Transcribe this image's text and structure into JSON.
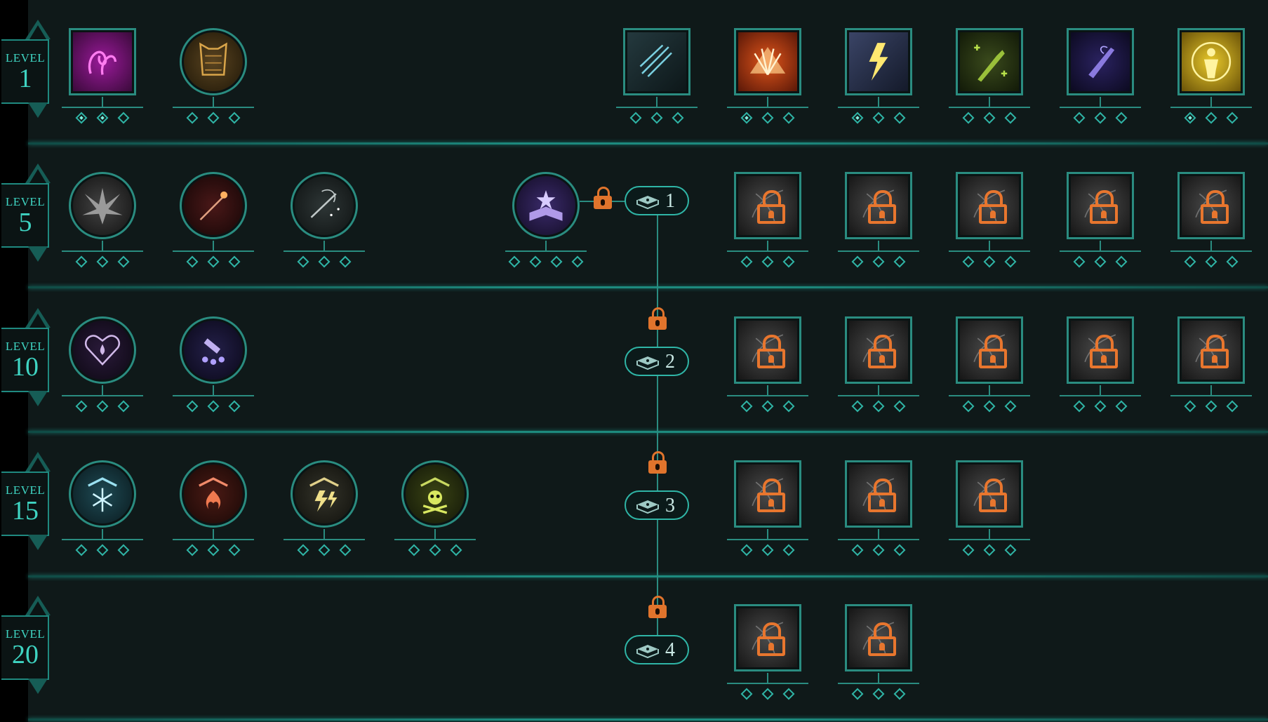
{
  "levels": [
    {
      "label": "LEVEL",
      "number": "1"
    },
    {
      "label": "LEVEL",
      "number": "5"
    },
    {
      "label": "LEVEL",
      "number": "10"
    },
    {
      "label": "LEVEL",
      "number": "15"
    },
    {
      "label": "LEVEL",
      "number": "20"
    }
  ],
  "unlock_tiers": [
    "1",
    "2",
    "3",
    "4"
  ],
  "colors": {
    "background": "#0f1919",
    "accent": "#2fb5a6",
    "level_text": "#3fd4c2",
    "lock": "#e0742c"
  },
  "rows": [
    {
      "level": "1",
      "talents": [
        {
          "icon": "magenta-wisps-icon",
          "shape": "square",
          "pips": 3,
          "filled": 2
        },
        {
          "icon": "golden-armor-icon",
          "shape": "circle",
          "pips": 3,
          "filled": 0
        },
        {
          "icon": "claw-slash-icon",
          "shape": "square",
          "pips": 3,
          "filled": 0
        },
        {
          "icon": "fire-fan-icon",
          "shape": "square",
          "pips": 3,
          "filled": 1
        },
        {
          "icon": "lightning-icon",
          "shape": "square",
          "pips": 3,
          "filled": 1
        },
        {
          "icon": "healing-hand-icon",
          "shape": "square",
          "pips": 3,
          "filled": 0
        },
        {
          "icon": "shadow-dagger-icon",
          "shape": "square",
          "pips": 3,
          "filled": 0
        },
        {
          "icon": "golden-figure-icon",
          "shape": "square",
          "pips": 3,
          "filled": 1
        }
      ]
    },
    {
      "level": "5",
      "talents": [
        {
          "icon": "burst-icon",
          "shape": "circle",
          "pips": 3,
          "filled": 0
        },
        {
          "icon": "magic-wand-icon",
          "shape": "circle",
          "pips": 3,
          "filled": 0
        },
        {
          "icon": "sparkle-wand-icon",
          "shape": "circle",
          "pips": 3,
          "filled": 0
        },
        {
          "icon": "spellbook-icon",
          "shape": "circle",
          "pips": 4,
          "filled": 0
        },
        {
          "icon": "locked-talent-icon",
          "shape": "square",
          "pips": 3,
          "filled": 0
        },
        {
          "icon": "locked-talent-icon",
          "shape": "square",
          "pips": 3,
          "filled": 0
        },
        {
          "icon": "locked-talent-icon",
          "shape": "square",
          "pips": 3,
          "filled": 0
        },
        {
          "icon": "locked-talent-icon",
          "shape": "square",
          "pips": 3,
          "filled": 0
        },
        {
          "icon": "locked-talent-icon",
          "shape": "square",
          "pips": 3,
          "filled": 0
        }
      ]
    },
    {
      "level": "10",
      "talents": [
        {
          "icon": "heart-drop-icon",
          "shape": "circle",
          "pips": 3,
          "filled": 0
        },
        {
          "icon": "hand-orbs-icon",
          "shape": "circle",
          "pips": 3,
          "filled": 0
        },
        {
          "icon": "locked-talent-icon",
          "shape": "square",
          "pips": 3,
          "filled": 0
        },
        {
          "icon": "locked-talent-icon",
          "shape": "square",
          "pips": 3,
          "filled": 0
        },
        {
          "icon": "locked-talent-icon",
          "shape": "square",
          "pips": 3,
          "filled": 0
        },
        {
          "icon": "locked-talent-icon",
          "shape": "square",
          "pips": 3,
          "filled": 0
        },
        {
          "icon": "locked-talent-icon",
          "shape": "square",
          "pips": 3,
          "filled": 0
        }
      ]
    },
    {
      "level": "15",
      "talents": [
        {
          "icon": "frost-rank-icon",
          "shape": "circle",
          "pips": 3,
          "filled": 0
        },
        {
          "icon": "fire-rank-icon",
          "shape": "circle",
          "pips": 3,
          "filled": 0
        },
        {
          "icon": "lightning-rank-icon",
          "shape": "circle",
          "pips": 3,
          "filled": 0
        },
        {
          "icon": "poison-rank-icon",
          "shape": "circle",
          "pips": 3,
          "filled": 0
        },
        {
          "icon": "locked-talent-icon",
          "shape": "square",
          "pips": 3,
          "filled": 0
        },
        {
          "icon": "locked-talent-icon",
          "shape": "square",
          "pips": 3,
          "filled": 0
        },
        {
          "icon": "locked-talent-icon",
          "shape": "square",
          "pips": 3,
          "filled": 0
        }
      ]
    },
    {
      "level": "20",
      "talents": [
        {
          "icon": "locked-talent-icon",
          "shape": "square",
          "pips": 3,
          "filled": 0
        },
        {
          "icon": "locked-talent-icon",
          "shape": "square",
          "pips": 3,
          "filled": 0
        }
      ]
    }
  ]
}
